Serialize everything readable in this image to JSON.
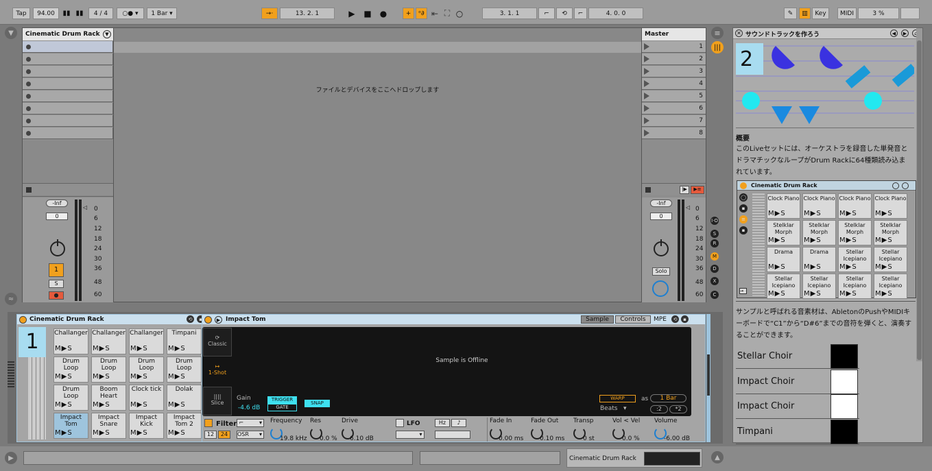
{
  "colors": {
    "accent": "#f1a01d",
    "selection": "#9ec4dd",
    "cyan": "#3ee0f0"
  },
  "transport": {
    "tap": "Tap",
    "tempo": "94.00",
    "sig": "4 / 4",
    "quant": "1 Bar",
    "pos": "13.  2.  1",
    "loop_start": "3.  1.  1",
    "loop_len": "4.  0.  0",
    "key": "Key",
    "midi": "MIDI",
    "cpu": "3 %"
  },
  "track": {
    "name": "Cinematic Drum Rack",
    "drop_text": "ファイルとデバイスをここへドロップします",
    "vol": "-Inf",
    "pan": "0",
    "num": "1",
    "solo": "S"
  },
  "meter_scale": [
    "0",
    "6",
    "12",
    "18",
    "24",
    "30",
    "36",
    "48",
    "60"
  ],
  "master": {
    "name": "Master",
    "slots": [
      "1",
      "2",
      "3",
      "4",
      "5",
      "6",
      "7",
      "8"
    ],
    "vol": "-Inf",
    "pan": "0",
    "solo": "Solo"
  },
  "io_buttons": [
    "I·O",
    "S",
    "R",
    "M",
    "D",
    "X",
    "C"
  ],
  "help": {
    "title": "サウンドトラックを作ろう",
    "page": "2",
    "section": "概要",
    "para1": "このLiveセットには、オーケストラを録音した単発音とドラマチックなループがDrum Rackに64種類読み込まれています。",
    "rack_name": "Cinematic Drum Rack",
    "small_pads": [
      "Clock Piano",
      "Clock Piano",
      "Clock Piano",
      "Clock Piano",
      "Stelklar Morph",
      "Stelklar Morph",
      "Stelklar Morph",
      "Stelklar Morph",
      "Drama",
      "Drama",
      "Stellar Icepiano",
      "Stellar Icepiano",
      "Stellar Icepiano",
      "Stellar Icepiano",
      "Stellar Icepiano",
      "Stellar Icepiano"
    ],
    "para2": "サンプルと呼ばれる音素材は、AbletonのPushやMIDIキーボードで“C1”から“D#6”までの音符を弾くと、演奏することができます。",
    "keys": [
      "Stellar Choir",
      "Impact Choir",
      "Impact Choir",
      "Timpani"
    ]
  },
  "device": {
    "rack_title": "Cinematic Drum Rack",
    "rack_num": "1",
    "pads": [
      "Challanger",
      "Challanger",
      "Challanger",
      "Timpani",
      "Drum Loop",
      "Drum Loop",
      "Drum Loop",
      "Drum Loop",
      "Drum Loop",
      "Boom Heart",
      "Clock tick",
      "Dolak",
      "Impact Tom",
      "Impact Snare",
      "Impact Kick",
      "Impact Tom 2"
    ],
    "pad_ms": [
      "M",
      "S"
    ],
    "sampler_title": "Impact Tom",
    "tab_sample": "Sample",
    "tab_controls": "Controls",
    "mpe": "MPE",
    "mode_classic": "Classic",
    "mode_1shot": "1-Shot",
    "mode_slice": "Slice",
    "offline": "Sample is Offline",
    "gain_label": "Gain",
    "gain_val": "-4.6 dB",
    "trigger": "TRIGGER",
    "gate": "GATE",
    "snap": "SNAP",
    "warp": "WARP",
    "as": "as",
    "bar": "1 Bar",
    "beats": "Beats",
    "div2": ":2",
    "mul2": "*2",
    "filter": "Filter",
    "f12": "12",
    "f24": "24",
    "osr": "OSR",
    "freq_label": "Frequency",
    "freq_val": "19.8 kHz",
    "res_label": "Res",
    "res_val": "0.0 %",
    "drive_label": "Drive",
    "drive_val": "6.10 dB",
    "lfo": "LFO",
    "hz": "Hz",
    "fadein_label": "Fade In",
    "fadein_val": "0.00 ms",
    "fadeout_label": "Fade Out",
    "fadeout_val": "0.10 ms",
    "transp_label": "Transp",
    "transp_val": "0 st",
    "volvel_label": "Vol < Vel",
    "volvel_val": "0.0 %",
    "volume_label": "Volume",
    "volume_val": "-6.00 dB"
  },
  "status": {
    "track": "Cinematic Drum Rack"
  }
}
